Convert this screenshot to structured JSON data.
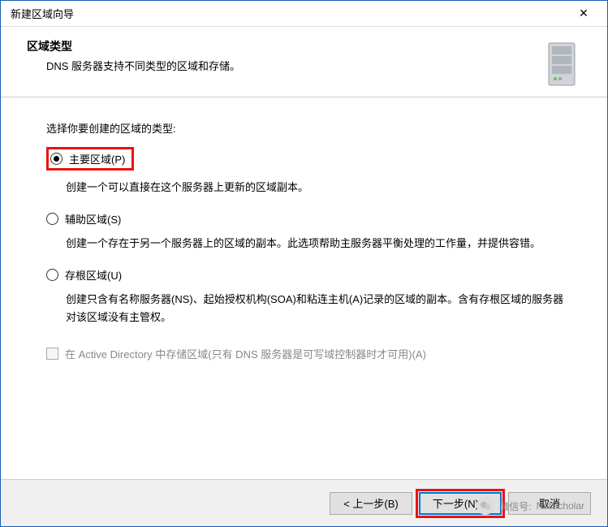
{
  "title": "新建区域向导",
  "close": "✕",
  "header": {
    "title": "区域类型",
    "subtitle": "DNS 服务器支持不同类型的区域和存储。"
  },
  "prompt": "选择你要创建的区域的类型:",
  "options": {
    "primary": {
      "label": "主要区域(P)",
      "desc": "创建一个可以直接在这个服务器上更新的区域副本。"
    },
    "secondary": {
      "label": "辅助区域(S)",
      "desc": "创建一个存在于另一个服务器上的区域的副本。此选项帮助主服务器平衡处理的工作量，并提供容错。"
    },
    "stub": {
      "label": "存根区域(U)",
      "desc": "创建只含有名称服务器(NS)、起始授权机构(SOA)和粘连主机(A)记录的区域的副本。含有存根区域的服务器对该区域没有主管权。"
    }
  },
  "adCheckbox": "在 Active Directory 中存储区域(只有 DNS 服务器是可写域控制器时才可用)(A)",
  "buttons": {
    "back": "< 上一步(B)",
    "next": "下一步(N) >",
    "cancel": "取消"
  },
  "watermark": {
    "prefix": "微信号:",
    "id": "NetScholar"
  }
}
